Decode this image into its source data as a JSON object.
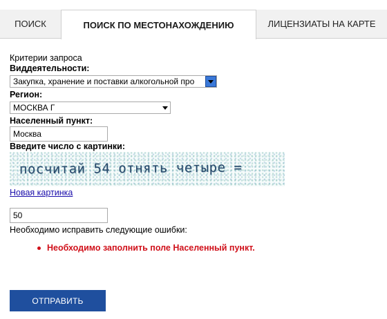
{
  "tabs": [
    {
      "label": "ПОИСК",
      "active": false
    },
    {
      "label": "ПОИСК ПО МЕСТОНАХОЖДЕНИЮ",
      "active": true
    },
    {
      "label": "ЛИЦЕНЗИАТЫ НА КАРТЕ",
      "active": false
    }
  ],
  "form": {
    "criteria_title": "Критерии запроса",
    "activity": {
      "label": "Виддеятельности:",
      "value": "Закупка, хранение и поставки алкогольной про"
    },
    "region": {
      "label": "Регион:",
      "value": "МОСКВА Г"
    },
    "locality": {
      "label": "Населенный пункт:",
      "value": "Москва"
    },
    "captcha": {
      "label": "Введите число с картинки:",
      "image_text": "посчитай 54 отнять четыре =",
      "new_image_link": "Новая картинка",
      "answer_value": "50"
    },
    "errors": {
      "heading": "Необходимо исправить следующие ошибки:",
      "items": [
        "Необходимо заполнить поле Населенный пункт."
      ]
    },
    "submit_label": "ОТПРАВИТЬ"
  },
  "colors": {
    "accent": "#1f4f9e",
    "error": "#d0101a",
    "link": "#1a0dab"
  }
}
